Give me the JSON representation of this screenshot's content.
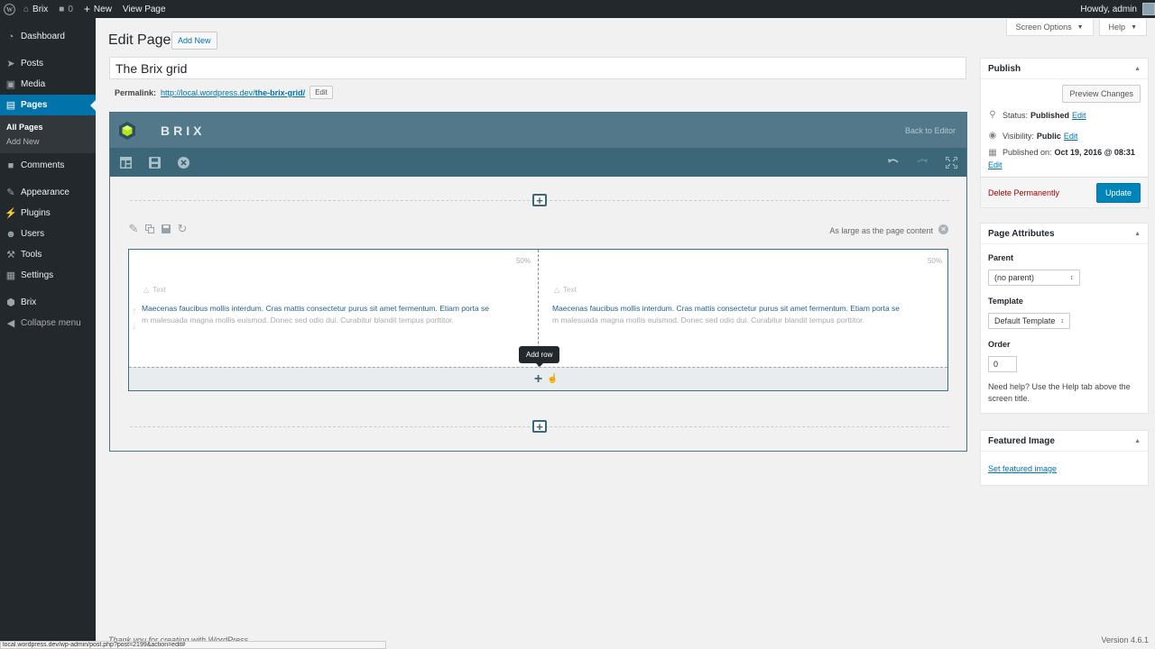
{
  "adminbar": {
    "site_name": "Brix",
    "comments_count": "0",
    "new_label": "New",
    "view_page_label": "View Page",
    "howdy": "Howdy, admin"
  },
  "sidebar": {
    "items": [
      {
        "label": "Dashboard",
        "icon": "dashboard-icon"
      },
      {
        "label": "Posts",
        "icon": "pin-icon"
      },
      {
        "label": "Media",
        "icon": "media-icon"
      },
      {
        "label": "Pages",
        "icon": "pages-icon"
      },
      {
        "label": "Comments",
        "icon": "comment-icon"
      },
      {
        "label": "Appearance",
        "icon": "brush-icon"
      },
      {
        "label": "Plugins",
        "icon": "plugin-icon"
      },
      {
        "label": "Users",
        "icon": "user-icon"
      },
      {
        "label": "Tools",
        "icon": "wrench-icon"
      },
      {
        "label": "Settings",
        "icon": "settings-icon"
      },
      {
        "label": "Brix",
        "icon": "brix-icon"
      }
    ],
    "submenu": [
      "All Pages",
      "Add New"
    ],
    "collapse": "Collapse menu"
  },
  "header": {
    "screen_options": "Screen Options",
    "help": "Help",
    "title": "Edit Page",
    "add_new": "Add New"
  },
  "post": {
    "title_value": "The Brix grid",
    "permalink_label": "Permalink:",
    "permalink_base": "http://local.wordpress.dev/",
    "permalink_slug": "the-brix-grid/",
    "permalink_edit": "Edit"
  },
  "brix": {
    "logo_text": "BRIX",
    "back_to_editor": "Back to Editor",
    "row_width": "As large as the page content",
    "columns": [
      {
        "percent": "50%",
        "block_label": "Text",
        "line1": "Maecenas faucibus mollis interdum. Cras mattis consectetur purus sit amet fermentum. Etiam porta se",
        "line2": "m malesuada magna mollis euismod. Donec sed odio dui. Curabitur blandit tempus porttitor."
      },
      {
        "percent": "50%",
        "block_label": "Text",
        "line1": "Maecenas faucibus mollis interdum. Cras mattis consectetur purus sit amet fermentum. Etiam porta se",
        "line2": "m malesuada magna mollis euismod. Donec sed odio dui. Curabitur blandit tempus porttitor."
      }
    ],
    "tooltip": "Add row"
  },
  "publish": {
    "title": "Publish",
    "preview": "Preview Changes",
    "status_label": "Status:",
    "status_value": "Published",
    "visibility_label": "Visibility:",
    "visibility_value": "Public",
    "published_label": "Published on:",
    "published_value": "Oct 19, 2016 @ 08:31",
    "edit": "Edit",
    "delete": "Delete Permanently",
    "update": "Update"
  },
  "attributes": {
    "title": "Page Attributes",
    "parent_label": "Parent",
    "parent_value": "(no parent)",
    "template_label": "Template",
    "template_value": "Default Template",
    "order_label": "Order",
    "order_value": "0",
    "help": "Need help? Use the Help tab above the screen title."
  },
  "featured": {
    "title": "Featured Image",
    "set_link": "Set featured image"
  },
  "footer": {
    "thanks": "Thank you for creating with WordPress.",
    "version": "Version 4.6.1",
    "status_url": "local.wordpress.dev/wp-admin/post.php?post=2199&action=edit#"
  },
  "colors": {
    "accent": "#0073aa",
    "brix_header": "#53788a",
    "brix_toolbar": "#3b6778",
    "admin_bg": "#23282d"
  }
}
